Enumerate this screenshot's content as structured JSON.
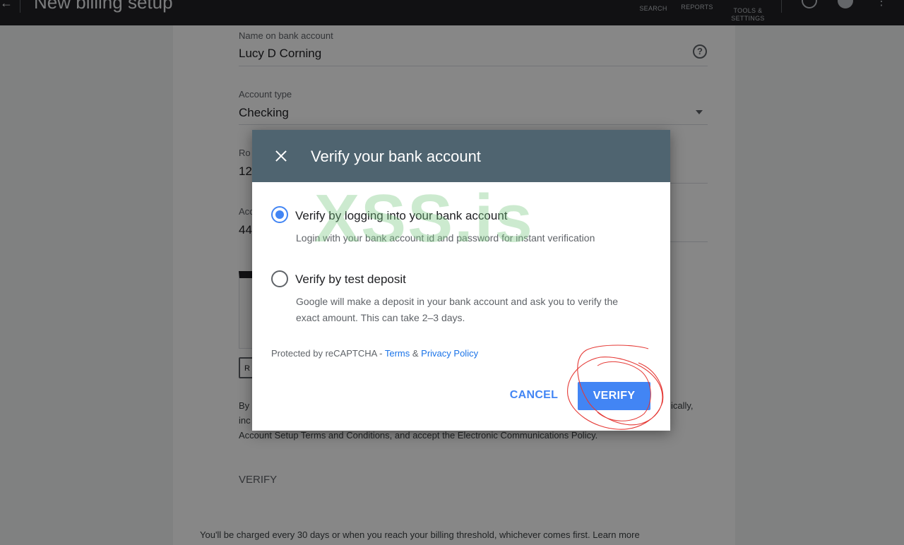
{
  "header": {
    "title": "New billing setup",
    "nav": [
      "SEARCH",
      "REPORTS",
      "TOOLS &\nSETTINGS"
    ]
  },
  "form": {
    "name_label": "Name on bank account",
    "name_value": "Lucy D Corning",
    "account_type_label": "Account type",
    "account_type_value": "Checking",
    "routing_label_partial": "Ro",
    "routing_value_partial": "12",
    "account_label_partial": "Acc",
    "account_value_partial": "44",
    "small_box_text": "R",
    "terms_line1_start": "By",
    "terms_line1_end": "ically,",
    "terms_line2_start": "inc",
    "terms_line3": "Account Setup Terms and Conditions, and accept the Electronic Communications Policy.",
    "verify_section": "VERIFY",
    "footnote": "You'll be charged every 30 days or when you reach your billing threshold, whichever comes first. Learn more"
  },
  "dialog": {
    "title": "Verify your bank account",
    "option1_label": "Verify by logging into your bank account",
    "option1_desc": "Login with your bank account id and password for instant verification",
    "option1_selected": true,
    "option2_label": "Verify by test deposit",
    "option2_desc_line1": "Google will make a deposit in your bank account and ask you to verify the",
    "option2_desc_line2": "exact amount. This can take 2–3 days.",
    "recaptcha_text": "Protected by reCAPTCHA - ",
    "terms_link": "Terms",
    "amp": " & ",
    "privacy_link": "Privacy Policy",
    "cancel": "CANCEL",
    "verify": "VERIFY"
  },
  "watermark": "XSS.is",
  "colors": {
    "header_bg": "#4f6470",
    "primary": "#4285f4",
    "scribble": "#e53935",
    "watermark": "#78c882"
  }
}
